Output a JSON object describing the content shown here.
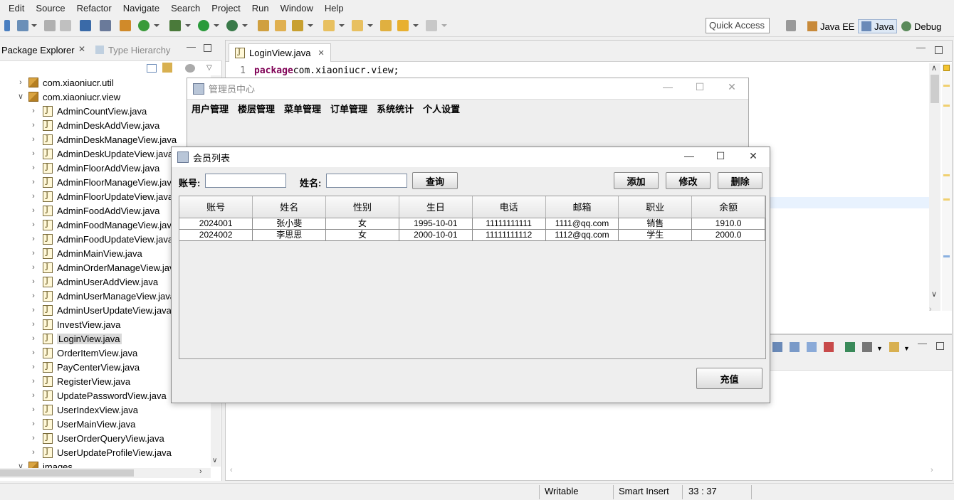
{
  "menubar": {
    "items": [
      "Edit",
      "Source",
      "Refactor",
      "Navigate",
      "Search",
      "Project",
      "Run",
      "Window",
      "Help"
    ]
  },
  "toolbar": {
    "quick_access": "Quick Access",
    "perspectives": [
      "Java EE",
      "Java",
      "Debug"
    ]
  },
  "package_explorer": {
    "tab_label": "Package Explorer",
    "other_tab": "Type Hierarchy",
    "packages": [
      "com.xiaoniucr.util",
      "com.xiaoniucr.view"
    ],
    "files": [
      "AdminCountView.java",
      "AdminDeskAddView.java",
      "AdminDeskManageView.java",
      "AdminDeskUpdateView.java",
      "AdminFloorAddView.java",
      "AdminFloorManageView.java",
      "AdminFloorUpdateView.java",
      "AdminFoodAddView.java",
      "AdminFoodManageView.java",
      "AdminFoodUpdateView.java",
      "AdminMainView.java",
      "AdminOrderManageView.java",
      "AdminUserAddView.java",
      "AdminUserManageView.java",
      "AdminUserUpdateView.java",
      "InvestView.java",
      "LoginView.java",
      "OrderItemView.java",
      "PayCenterView.java",
      "RegisterView.java",
      "UpdatePasswordView.java",
      "UserIndexView.java",
      "UserMainView.java",
      "UserOrderQueryView.java",
      "UserUpdateProfileView.java"
    ],
    "trailing_folder": "images",
    "selected": "LoginView.java"
  },
  "editor": {
    "tab_label": "LoginView.java",
    "line_no": "1",
    "keyword": "package",
    "code": " com.xiaoniucr.view;"
  },
  "status": {
    "writable": "Writable",
    "insert_mode": "Smart Insert",
    "position": "33 : 37"
  },
  "admin_window": {
    "title": "管理员中心",
    "menu": [
      "用户管理",
      "楼层管理",
      "菜单管理",
      "订单管理",
      "系统统计",
      "个人设置"
    ]
  },
  "member_window": {
    "title": "会员列表",
    "account_label": "账号:",
    "name_label": "姓名:",
    "account_value": "",
    "name_value": "",
    "query_button": "查询",
    "add_button": "添加",
    "edit_button": "修改",
    "delete_button": "删除",
    "recharge_button": "充值",
    "columns": [
      "账号",
      "姓名",
      "性别",
      "生日",
      "电话",
      "邮箱",
      "职业",
      "余额"
    ],
    "rows": [
      [
        "2024001",
        "张小斐",
        "女",
        "1995-10-01",
        "11111111111",
        "1111@qq.com",
        "销售",
        "1910.0"
      ],
      [
        "2024002",
        "李思思",
        "女",
        "2000-10-01",
        "11111111112",
        "1112@qq.com",
        "学生",
        "2000.0"
      ]
    ]
  }
}
